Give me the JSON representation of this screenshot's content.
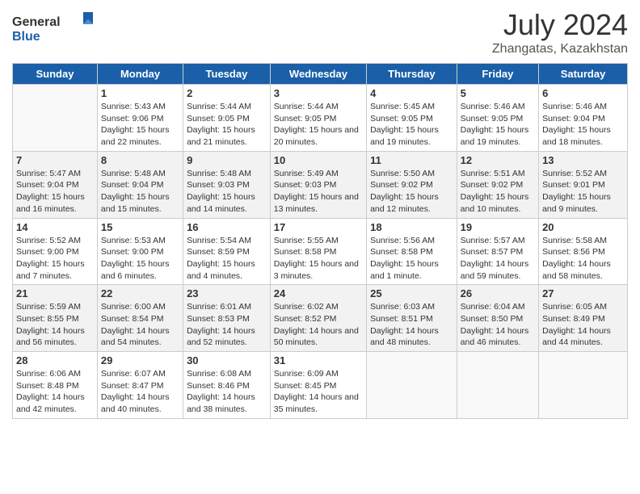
{
  "logo": {
    "general": "General",
    "blue": "Blue"
  },
  "title": "July 2024",
  "location": "Zhangatas, Kazakhstan",
  "headers": [
    "Sunday",
    "Monday",
    "Tuesday",
    "Wednesday",
    "Thursday",
    "Friday",
    "Saturday"
  ],
  "weeks": [
    {
      "shaded": false,
      "days": [
        {
          "num": "",
          "empty": true
        },
        {
          "num": "1",
          "sunrise": "Sunrise: 5:43 AM",
          "sunset": "Sunset: 9:06 PM",
          "daylight": "Daylight: 15 hours and 22 minutes."
        },
        {
          "num": "2",
          "sunrise": "Sunrise: 5:44 AM",
          "sunset": "Sunset: 9:05 PM",
          "daylight": "Daylight: 15 hours and 21 minutes."
        },
        {
          "num": "3",
          "sunrise": "Sunrise: 5:44 AM",
          "sunset": "Sunset: 9:05 PM",
          "daylight": "Daylight: 15 hours and 20 minutes."
        },
        {
          "num": "4",
          "sunrise": "Sunrise: 5:45 AM",
          "sunset": "Sunset: 9:05 PM",
          "daylight": "Daylight: 15 hours and 19 minutes."
        },
        {
          "num": "5",
          "sunrise": "Sunrise: 5:46 AM",
          "sunset": "Sunset: 9:05 PM",
          "daylight": "Daylight: 15 hours and 19 minutes."
        },
        {
          "num": "6",
          "sunrise": "Sunrise: 5:46 AM",
          "sunset": "Sunset: 9:04 PM",
          "daylight": "Daylight: 15 hours and 18 minutes."
        }
      ]
    },
    {
      "shaded": true,
      "days": [
        {
          "num": "7",
          "sunrise": "Sunrise: 5:47 AM",
          "sunset": "Sunset: 9:04 PM",
          "daylight": "Daylight: 15 hours and 16 minutes."
        },
        {
          "num": "8",
          "sunrise": "Sunrise: 5:48 AM",
          "sunset": "Sunset: 9:04 PM",
          "daylight": "Daylight: 15 hours and 15 minutes."
        },
        {
          "num": "9",
          "sunrise": "Sunrise: 5:48 AM",
          "sunset": "Sunset: 9:03 PM",
          "daylight": "Daylight: 15 hours and 14 minutes."
        },
        {
          "num": "10",
          "sunrise": "Sunrise: 5:49 AM",
          "sunset": "Sunset: 9:03 PM",
          "daylight": "Daylight: 15 hours and 13 minutes."
        },
        {
          "num": "11",
          "sunrise": "Sunrise: 5:50 AM",
          "sunset": "Sunset: 9:02 PM",
          "daylight": "Daylight: 15 hours and 12 minutes."
        },
        {
          "num": "12",
          "sunrise": "Sunrise: 5:51 AM",
          "sunset": "Sunset: 9:02 PM",
          "daylight": "Daylight: 15 hours and 10 minutes."
        },
        {
          "num": "13",
          "sunrise": "Sunrise: 5:52 AM",
          "sunset": "Sunset: 9:01 PM",
          "daylight": "Daylight: 15 hours and 9 minutes."
        }
      ]
    },
    {
      "shaded": false,
      "days": [
        {
          "num": "14",
          "sunrise": "Sunrise: 5:52 AM",
          "sunset": "Sunset: 9:00 PM",
          "daylight": "Daylight: 15 hours and 7 minutes."
        },
        {
          "num": "15",
          "sunrise": "Sunrise: 5:53 AM",
          "sunset": "Sunset: 9:00 PM",
          "daylight": "Daylight: 15 hours and 6 minutes."
        },
        {
          "num": "16",
          "sunrise": "Sunrise: 5:54 AM",
          "sunset": "Sunset: 8:59 PM",
          "daylight": "Daylight: 15 hours and 4 minutes."
        },
        {
          "num": "17",
          "sunrise": "Sunrise: 5:55 AM",
          "sunset": "Sunset: 8:58 PM",
          "daylight": "Daylight: 15 hours and 3 minutes."
        },
        {
          "num": "18",
          "sunrise": "Sunrise: 5:56 AM",
          "sunset": "Sunset: 8:58 PM",
          "daylight": "Daylight: 15 hours and 1 minute."
        },
        {
          "num": "19",
          "sunrise": "Sunrise: 5:57 AM",
          "sunset": "Sunset: 8:57 PM",
          "daylight": "Daylight: 14 hours and 59 minutes."
        },
        {
          "num": "20",
          "sunrise": "Sunrise: 5:58 AM",
          "sunset": "Sunset: 8:56 PM",
          "daylight": "Daylight: 14 hours and 58 minutes."
        }
      ]
    },
    {
      "shaded": true,
      "days": [
        {
          "num": "21",
          "sunrise": "Sunrise: 5:59 AM",
          "sunset": "Sunset: 8:55 PM",
          "daylight": "Daylight: 14 hours and 56 minutes."
        },
        {
          "num": "22",
          "sunrise": "Sunrise: 6:00 AM",
          "sunset": "Sunset: 8:54 PM",
          "daylight": "Daylight: 14 hours and 54 minutes."
        },
        {
          "num": "23",
          "sunrise": "Sunrise: 6:01 AM",
          "sunset": "Sunset: 8:53 PM",
          "daylight": "Daylight: 14 hours and 52 minutes."
        },
        {
          "num": "24",
          "sunrise": "Sunrise: 6:02 AM",
          "sunset": "Sunset: 8:52 PM",
          "daylight": "Daylight: 14 hours and 50 minutes."
        },
        {
          "num": "25",
          "sunrise": "Sunrise: 6:03 AM",
          "sunset": "Sunset: 8:51 PM",
          "daylight": "Daylight: 14 hours and 48 minutes."
        },
        {
          "num": "26",
          "sunrise": "Sunrise: 6:04 AM",
          "sunset": "Sunset: 8:50 PM",
          "daylight": "Daylight: 14 hours and 46 minutes."
        },
        {
          "num": "27",
          "sunrise": "Sunrise: 6:05 AM",
          "sunset": "Sunset: 8:49 PM",
          "daylight": "Daylight: 14 hours and 44 minutes."
        }
      ]
    },
    {
      "shaded": false,
      "days": [
        {
          "num": "28",
          "sunrise": "Sunrise: 6:06 AM",
          "sunset": "Sunset: 8:48 PM",
          "daylight": "Daylight: 14 hours and 42 minutes."
        },
        {
          "num": "29",
          "sunrise": "Sunrise: 6:07 AM",
          "sunset": "Sunset: 8:47 PM",
          "daylight": "Daylight: 14 hours and 40 minutes."
        },
        {
          "num": "30",
          "sunrise": "Sunrise: 6:08 AM",
          "sunset": "Sunset: 8:46 PM",
          "daylight": "Daylight: 14 hours and 38 minutes."
        },
        {
          "num": "31",
          "sunrise": "Sunrise: 6:09 AM",
          "sunset": "Sunset: 8:45 PM",
          "daylight": "Daylight: 14 hours and 35 minutes."
        },
        {
          "num": "",
          "empty": true
        },
        {
          "num": "",
          "empty": true
        },
        {
          "num": "",
          "empty": true
        }
      ]
    }
  ]
}
